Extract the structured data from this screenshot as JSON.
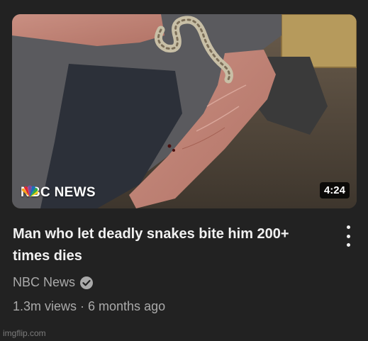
{
  "video": {
    "title": "Man who let deadly snakes bite him 200+ times dies",
    "duration": "4:24",
    "thumbnail_logo_text": "NBC NEWS",
    "channel": "NBC News",
    "meta": "1.3m views · 6 months ago"
  },
  "icons": {
    "menu": "more-vert-icon",
    "verified": "verified-check-icon",
    "logo": "nbc-peacock-icon"
  },
  "watermark": "imgflip.com",
  "colors": {
    "background": "#222222",
    "title": "#f1f1f1",
    "secondary_text": "#aaaaaa",
    "duration_badge": "#000000"
  }
}
